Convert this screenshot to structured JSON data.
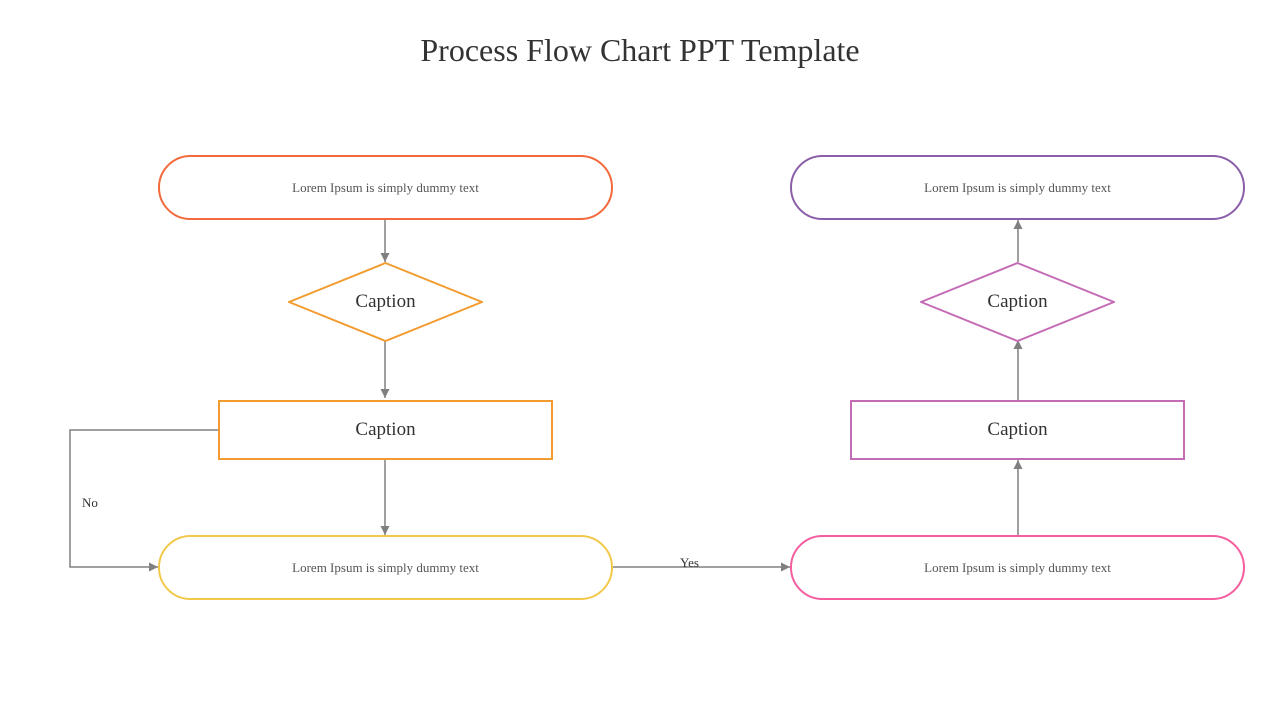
{
  "title": "Process Flow Chart PPT Template",
  "left": {
    "terminator_top": "Lorem Ipsum is simply dummy text",
    "decision": "Caption",
    "process": "Caption",
    "terminator_bottom": "Lorem Ipsum is simply dummy text"
  },
  "right": {
    "terminator_top": "Lorem Ipsum is simply dummy text",
    "decision": "Caption",
    "process": "Caption",
    "terminator_bottom": "Lorem Ipsum is simply dummy text"
  },
  "labels": {
    "no": "No",
    "yes": "Yes"
  },
  "colors": {
    "orange_red": "#f26a3b",
    "orange": "#f29b2e",
    "yellow": "#f2c84b",
    "purple": "#8a5ea8",
    "magenta": "#c46bb5",
    "pink": "#f45d9e",
    "arrow": "#808080"
  }
}
